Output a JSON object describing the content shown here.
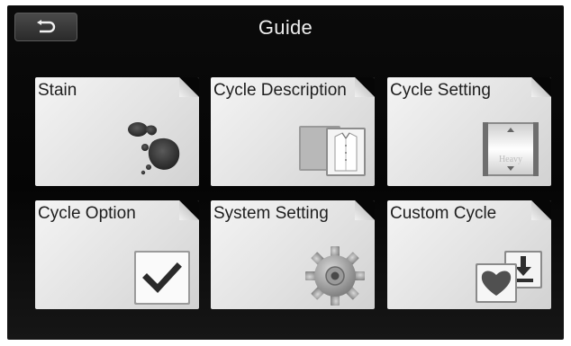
{
  "header": {
    "title": "Guide",
    "back_icon": "back-arrow-icon"
  },
  "tiles": [
    {
      "label": "Stain",
      "icon": "stain-icon"
    },
    {
      "label": "Cycle Description",
      "icon": "shirt-icon"
    },
    {
      "label": "Cycle Setting",
      "icon": "cycle-selector-icon",
      "icon_text": "Heavy"
    },
    {
      "label": "Cycle Option",
      "icon": "checkmark-icon"
    },
    {
      "label": "System Setting",
      "icon": "gear-icon"
    },
    {
      "label": "Custom Cycle",
      "icon": "heart-download-icon"
    }
  ]
}
